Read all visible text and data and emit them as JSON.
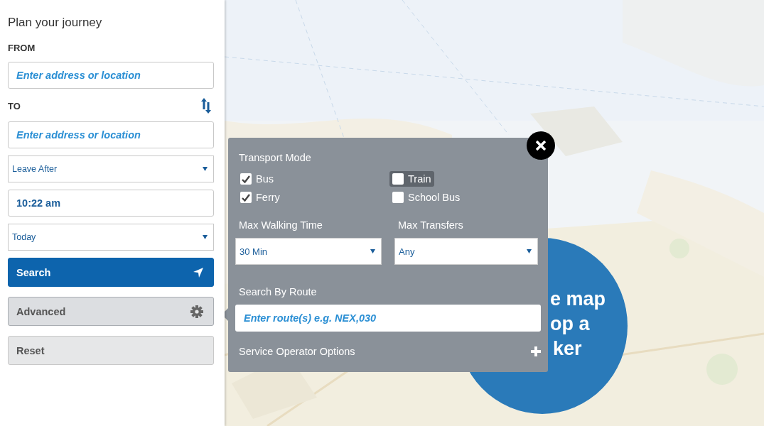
{
  "sidebar": {
    "title": "Plan your journey",
    "from_label": "FROM",
    "from_field": {
      "placeholder": "Enter address or location"
    },
    "to_label": "TO",
    "to_field": {
      "placeholder": "Enter address or location"
    },
    "departure_select": "Leave After",
    "time_field": {
      "value": "10:22 am"
    },
    "date_select": "Today",
    "buttons": [
      {
        "label": "Search",
        "kind": "primary"
      },
      {
        "label": "Advanced",
        "kind": "settings",
        "expanded": true
      },
      {
        "label": "Reset",
        "kind": "plain"
      }
    ]
  },
  "advanced_panel": {
    "heading": "Transport Mode",
    "modes": [
      {
        "label": "Bus",
        "checked": true,
        "highlighted": false
      },
      {
        "label": "Train",
        "checked": false,
        "highlighted": true
      },
      {
        "label": "Ferry",
        "checked": true,
        "highlighted": false
      },
      {
        "label": "School Bus",
        "checked": false,
        "highlighted": false
      }
    ],
    "max_walking_time": {
      "label": "Max Walking Time",
      "value": "30 Min"
    },
    "max_transfers": {
      "label": "Max Transfers",
      "value": "Any"
    },
    "route_search": {
      "label": "Search By Route",
      "placeholder": "Enter route(s) e.g. NEX,030"
    },
    "service_operator_options": {
      "label": "Service Operator Options",
      "expanded": false
    }
  },
  "map_prompt": {
    "lines": [
      "e map",
      "op a",
      "ker"
    ]
  }
}
